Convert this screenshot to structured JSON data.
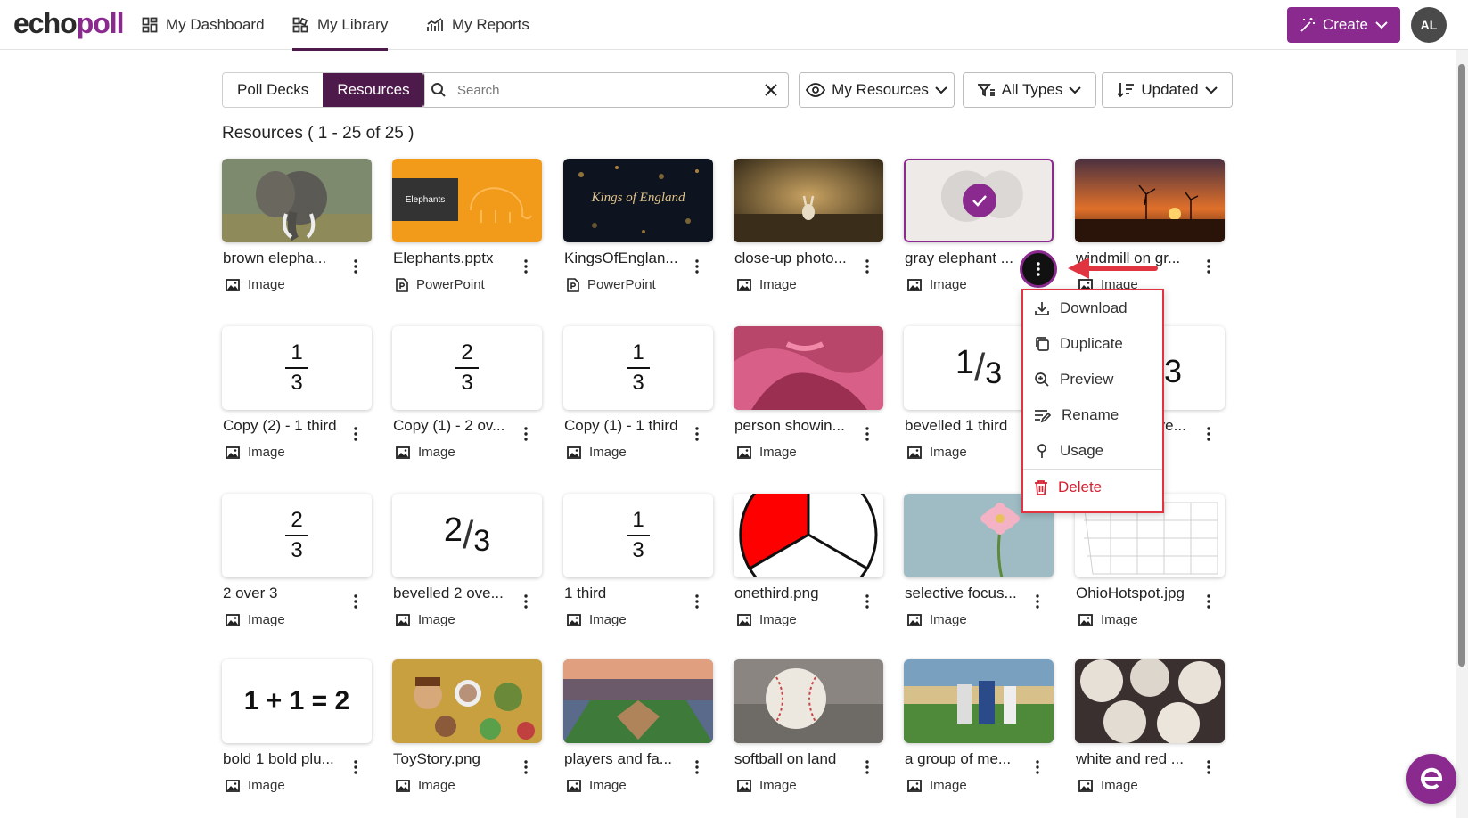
{
  "app": {
    "logo_a": "echo",
    "logo_b": "poll"
  },
  "nav": {
    "dashboard": "My Dashboard",
    "library": "My Library",
    "reports": "My Reports"
  },
  "header": {
    "create": "Create",
    "avatar": "AL"
  },
  "toolbar": {
    "tab_polls": "Poll Decks",
    "tab_resources": "Resources",
    "search_placeholder": "Search",
    "filter_owner": "My Resources",
    "filter_type": "All Types",
    "sort": "Updated"
  },
  "results_label": "Resources ( 1 - 25 of 25 )",
  "cards": [
    {
      "name": "brown elepha...",
      "type": "Image"
    },
    {
      "name": "Elephants.pptx",
      "type": "PowerPoint",
      "thumb_text": "Elephants"
    },
    {
      "name": "KingsOfEnglan...",
      "type": "PowerPoint",
      "thumb_text": "Kings of England"
    },
    {
      "name": "close-up photo...",
      "type": "Image"
    },
    {
      "name": "gray elephant ...",
      "type": "Image"
    },
    {
      "name": "windmill on gr...",
      "type": "Image"
    },
    {
      "name": "Copy (2) - 1 third",
      "type": "Image",
      "num": "1",
      "den": "3"
    },
    {
      "name": "Copy (1) - 2 ov...",
      "type": "Image",
      "num": "2",
      "den": "3"
    },
    {
      "name": "Copy (1) - 1 third",
      "type": "Image",
      "num": "1",
      "den": "3"
    },
    {
      "name": "person showin...",
      "type": "Image"
    },
    {
      "name": "bevelled 1 third",
      "type": "Image",
      "bev_num": "1",
      "bev_den": "3"
    },
    {
      "name": "bevelled 2 ove...",
      "type": "Image",
      "den": "3"
    },
    {
      "name": "2 over 3",
      "type": "Image",
      "num": "2",
      "den": "3"
    },
    {
      "name": "bevelled 2 ove...",
      "type": "Image",
      "bev_num": "2",
      "bev_den": "3"
    },
    {
      "name": "1 third",
      "type": "Image",
      "num": "1",
      "den": "3"
    },
    {
      "name": "onethird.png",
      "type": "Image"
    },
    {
      "name": "selective focus...",
      "type": "Image"
    },
    {
      "name": "OhioHotspot.jpg",
      "type": "Image"
    },
    {
      "name": "bold 1 bold plu...",
      "type": "Image",
      "eq": "1 + 1 = 2"
    },
    {
      "name": "ToyStory.png",
      "type": "Image"
    },
    {
      "name": "players and fa...",
      "type": "Image"
    },
    {
      "name": "softball on land",
      "type": "Image"
    },
    {
      "name": "a group of me...",
      "type": "Image"
    },
    {
      "name": "white and red ...",
      "type": "Image"
    }
  ],
  "menu": {
    "download": "Download",
    "duplicate": "Duplicate",
    "preview": "Preview",
    "rename": "Rename",
    "usage": "Usage",
    "delete": "Delete"
  },
  "colors": {
    "brand": "#8a2a8f",
    "active_tab": "#4e1a4b",
    "danger": "#d4202f"
  }
}
